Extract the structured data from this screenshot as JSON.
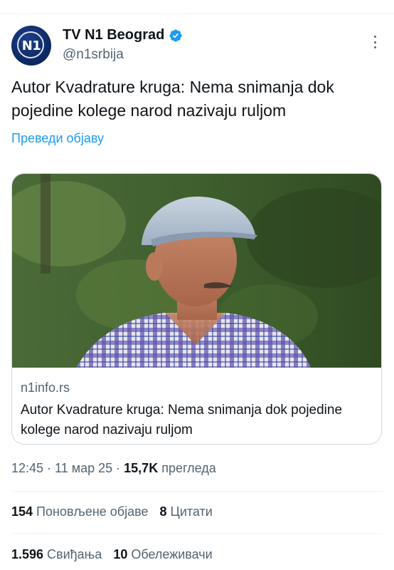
{
  "author": {
    "display_name": "TV N1 Beograd",
    "handle": "@n1srbija",
    "avatar_text": "N1",
    "verified": true
  },
  "tweet": {
    "text": "Autor Kvadrature kruga: Nema snimanja dok pojedine kolege narod nazivaju ruljom",
    "translate_label": "Преведи објаву"
  },
  "card": {
    "image_alt": "man-in-cap-plaid-shirt",
    "domain": "n1info.rs",
    "title": "Autor Kvadrature kruga: Nema snimanja dok pojedine kolege narod nazivaju ruljom"
  },
  "meta": {
    "time": "12:45",
    "sep": "·",
    "date": "11 мар 25",
    "views_count": "15,7K",
    "views_label": "прегледа"
  },
  "stats": {
    "reposts_count": "154",
    "reposts_label": "Поновљене објаве",
    "quotes_count": "8",
    "quotes_label": "Цитати",
    "likes_count": "1.596",
    "likes_label": "Свиђања",
    "bookmarks_count": "10",
    "bookmarks_label": "Обележивачи"
  },
  "colors": {
    "accent": "#1d9bf0",
    "text_primary": "#0f1419",
    "text_secondary": "#536471",
    "border": "#cfd9de"
  },
  "icons": [
    "verified-badge-icon",
    "more-options-icon"
  ]
}
